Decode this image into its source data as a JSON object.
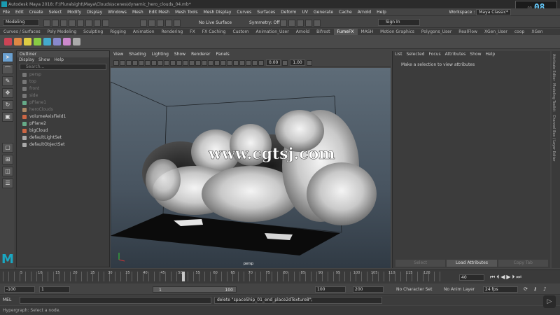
{
  "title": "Autodesk Maya 2018: F:\\Pluralsight\\Maya\\Clouds\\scenes\\dynamic_hero_clouds_04.mb*",
  "menus": [
    "File",
    "Edit",
    "Create",
    "Select",
    "Modify",
    "Display",
    "Windows",
    "Mesh",
    "Edit Mesh",
    "Mesh Tools",
    "Mesh Display",
    "Curves",
    "Surfaces",
    "Deform",
    "UV",
    "Generate",
    "Cache",
    "Arnold",
    "Help"
  ],
  "workspace": {
    "label": "Workspace :",
    "value": "Maya Classic*"
  },
  "timer": {
    "small": "00",
    "big": "08"
  },
  "status": {
    "mode": "Modeling",
    "live": "No Live Surface",
    "symmetry": "Symmetry: Off",
    "signin": "Sign In"
  },
  "shelf_tabs": [
    "Curves / Surfaces",
    "Poly Modeling",
    "Sculpting",
    "Rigging",
    "Animation",
    "Rendering",
    "FX",
    "FX Caching",
    "Custom",
    "Animation_User",
    "Arnold",
    "Bifrost",
    "FumeFX",
    "MASH",
    "Motion Graphics",
    "Polygons_User",
    "RealFlow",
    "XGen_User",
    "coop",
    "XGen"
  ],
  "active_shelf": "FumeFX",
  "outliner": {
    "title": "Outliner",
    "menu": [
      "Display",
      "Show",
      "Help"
    ],
    "search": "Search...",
    "items": [
      {
        "label": "persp",
        "dim": true
      },
      {
        "label": "top",
        "dim": true
      },
      {
        "label": "front",
        "dim": true
      },
      {
        "label": "side",
        "dim": true
      },
      {
        "label": "pPlane1",
        "dim": true
      },
      {
        "label": "heroClouds",
        "dim": true
      },
      {
        "label": "volumeAxisField1",
        "dim": false
      },
      {
        "label": "pPlane2",
        "dim": false
      },
      {
        "label": "bigCloud",
        "dim": false
      },
      {
        "label": "defaultLightSet",
        "dim": false
      },
      {
        "label": "defaultObjectSet",
        "dim": false
      }
    ]
  },
  "viewport": {
    "menu": [
      "View",
      "Shading",
      "Lighting",
      "Show",
      "Renderer",
      "Panels"
    ],
    "num1": "0.00",
    "num2": "1.00",
    "label": "persp",
    "watermark": "www.cgtsj.com"
  },
  "attr_editor": {
    "menu": [
      "List",
      "Selected",
      "Focus",
      "Attributes",
      "Show",
      "Help"
    ],
    "message": "Make a selection to view attributes",
    "buttons": [
      "Select",
      "Load Attributes",
      "Copy Tab"
    ]
  },
  "side_tabs": [
    "Attribute Editor",
    "Modeling Toolkit",
    "Channel Box / Layer Editor"
  ],
  "timeline": {
    "current": "40",
    "ticks": [
      "5",
      "10",
      "15",
      "20",
      "25",
      "30",
      "35",
      "40",
      "45",
      "50",
      "55",
      "60",
      "65",
      "70",
      "75",
      "80",
      "85",
      "90",
      "95",
      "100",
      "105",
      "110",
      "115",
      "120"
    ]
  },
  "range": {
    "start": "-100",
    "inner_start": "1",
    "slider_start": "1",
    "slider_end": "100",
    "inner_end": "100",
    "end": "200",
    "character": "No Character Set",
    "anim_layer": "No Anim Layer",
    "fps": "24 fps"
  },
  "command": {
    "lang": "MEL",
    "result": "delete \"spaceShip_01_end_place2dTexture8\";"
  },
  "help": "Hypergraph: Select a node."
}
